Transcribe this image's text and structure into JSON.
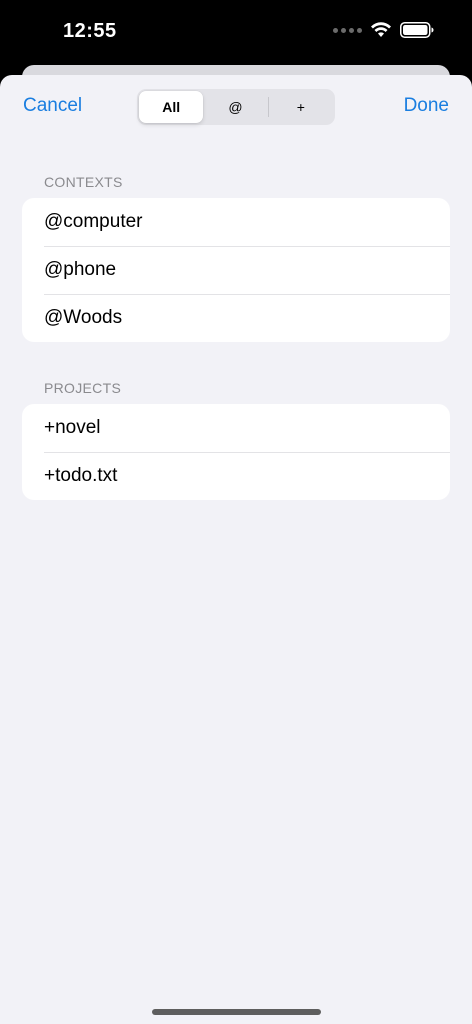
{
  "status_bar": {
    "time": "12:55"
  },
  "nav": {
    "cancel_label": "Cancel",
    "done_label": "Done"
  },
  "filter": {
    "segments": [
      "All",
      "@",
      "+"
    ],
    "selected": "All"
  },
  "contexts": {
    "header": "CONTEXTS",
    "items": [
      "@computer",
      "@phone",
      "@Woods"
    ]
  },
  "projects": {
    "header": "PROJECTS",
    "items": [
      "+novel",
      "+todo.txt"
    ]
  },
  "colors": {
    "accent": "#1a7ee0",
    "background": "#f2f2f7",
    "section_header": "#8a8a8e"
  }
}
